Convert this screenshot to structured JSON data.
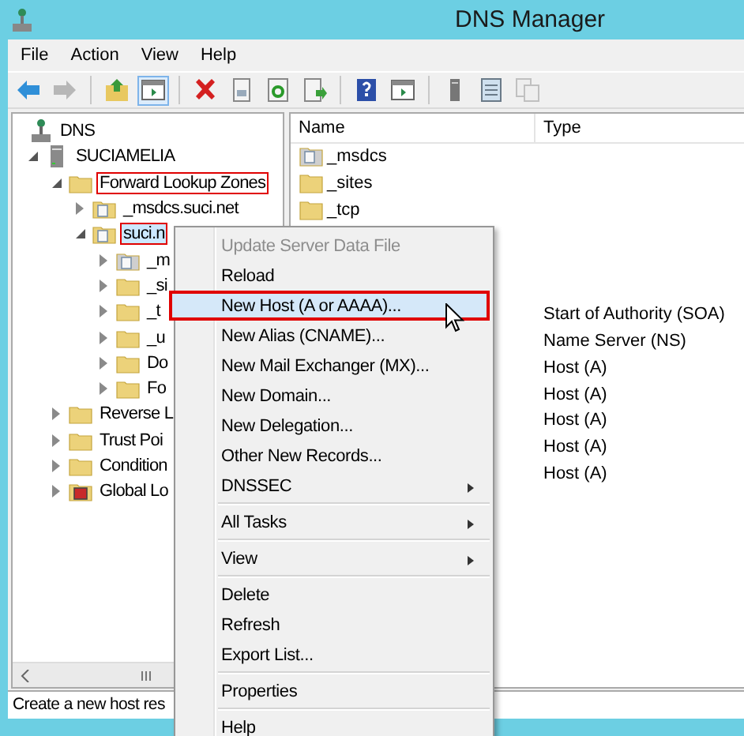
{
  "window": {
    "title": "DNS Manager"
  },
  "menu_bar": [
    "File",
    "Action",
    "View",
    "Help"
  ],
  "toolbar": [
    {
      "kind": "back",
      "disabled": false,
      "pressed": false
    },
    {
      "kind": "forward",
      "disabled": true,
      "pressed": false
    },
    {
      "kind": "sep",
      "disabled": false,
      "pressed": false
    },
    {
      "kind": "up",
      "disabled": false,
      "pressed": false
    },
    {
      "kind": "pane",
      "disabled": false,
      "pressed": true
    },
    {
      "kind": "sep",
      "disabled": false,
      "pressed": false
    },
    {
      "kind": "delete",
      "disabled": false,
      "pressed": false
    },
    {
      "kind": "props",
      "disabled": false,
      "pressed": false
    },
    {
      "kind": "refresh",
      "disabled": false,
      "pressed": false
    },
    {
      "kind": "export",
      "disabled": false,
      "pressed": false
    },
    {
      "kind": "sep",
      "disabled": false,
      "pressed": false
    },
    {
      "kind": "help",
      "disabled": false,
      "pressed": false
    },
    {
      "kind": "action",
      "disabled": false,
      "pressed": false
    },
    {
      "kind": "sep",
      "disabled": false,
      "pressed": false
    },
    {
      "kind": "server",
      "disabled": false,
      "pressed": false
    },
    {
      "kind": "list",
      "disabled": false,
      "pressed": false
    },
    {
      "kind": "copy",
      "disabled": true,
      "pressed": false
    }
  ],
  "tree": [
    {
      "label": "DNS",
      "kind": "dns",
      "selected": false,
      "outlined": false,
      "children": [
        {
          "label": "SUCIAMELIA",
          "kind": "server",
          "expanded": true,
          "selected": false,
          "outlined": false,
          "children": [
            {
              "label": "Forward Lookup Zones",
              "kind": "folder",
              "expanded": true,
              "selected": false,
              "outlined": true,
              "children": [
                {
                  "label": "_msdcs.suci.net",
                  "kind": "zone",
                  "expanded": false,
                  "selected": false,
                  "outlined": false
                },
                {
                  "label": "suci.n",
                  "kind": "zone",
                  "expanded": true,
                  "selected": true,
                  "outlined": true,
                  "children": [
                    {
                      "label": "_m",
                      "kind": "zone-gray",
                      "expanded": false,
                      "selected": false,
                      "outlined": false
                    },
                    {
                      "label": "_si",
                      "kind": "folder",
                      "expanded": false,
                      "selected": false,
                      "outlined": false
                    },
                    {
                      "label": "_t",
                      "kind": "folder",
                      "expanded": false,
                      "selected": false,
                      "outlined": false
                    },
                    {
                      "label": "_u",
                      "kind": "folder",
                      "expanded": false,
                      "selected": false,
                      "outlined": false
                    },
                    {
                      "label": "Do",
                      "kind": "folder",
                      "expanded": false,
                      "selected": false,
                      "outlined": false
                    },
                    {
                      "label": "Fo",
                      "kind": "folder",
                      "expanded": false,
                      "selected": false,
                      "outlined": false
                    }
                  ]
                }
              ]
            },
            {
              "label": "Reverse L",
              "kind": "folder",
              "expanded": false,
              "selected": false,
              "outlined": false
            },
            {
              "label": "Trust Poi",
              "kind": "folder",
              "expanded": false,
              "selected": false,
              "outlined": false
            },
            {
              "label": "Condition",
              "kind": "folder",
              "expanded": false,
              "selected": false,
              "outlined": false
            },
            {
              "label": "Global Lo",
              "kind": "global",
              "expanded": false,
              "selected": false,
              "outlined": false
            }
          ]
        }
      ]
    }
  ],
  "list": {
    "columns": [
      "Name",
      "Type"
    ],
    "rows": [
      {
        "name": "_msdcs",
        "kind": "zone-gray"
      },
      {
        "name": "_sites",
        "kind": "folder"
      },
      {
        "name": "_tcp",
        "kind": "folder"
      },
      {},
      {},
      {},
      {
        "type": "Start of Authority (SOA)"
      },
      {
        "type": "Name Server (NS)"
      },
      {
        "type": "Host (A)"
      },
      {
        "type": "Host (A)"
      },
      {
        "type": "Host (A)"
      },
      {
        "type": "Host (A)"
      },
      {
        "type": "Host (A)"
      }
    ]
  },
  "status_bar": "Create a new host res",
  "context_menu": [
    {
      "kind": "item",
      "label": "Update Server Data File",
      "disabled": true,
      "selected": false,
      "submenu": false,
      "outlined": false
    },
    {
      "kind": "item",
      "label": "Reload",
      "disabled": false,
      "selected": false,
      "submenu": false,
      "outlined": false
    },
    {
      "kind": "item",
      "label": "New Host (A or AAAA)...",
      "disabled": false,
      "selected": true,
      "submenu": false,
      "outlined": true
    },
    {
      "kind": "item",
      "label": "New Alias (CNAME)...",
      "disabled": false,
      "selected": false,
      "submenu": false,
      "outlined": false
    },
    {
      "kind": "item",
      "label": "New Mail Exchanger (MX)...",
      "disabled": false,
      "selected": false,
      "submenu": false,
      "outlined": false
    },
    {
      "kind": "item",
      "label": "New Domain...",
      "disabled": false,
      "selected": false,
      "submenu": false,
      "outlined": false
    },
    {
      "kind": "item",
      "label": "New Delegation...",
      "disabled": false,
      "selected": false,
      "submenu": false,
      "outlined": false
    },
    {
      "kind": "item",
      "label": "Other New Records...",
      "disabled": false,
      "selected": false,
      "submenu": false,
      "outlined": false
    },
    {
      "kind": "item",
      "label": "DNSSEC",
      "disabled": false,
      "selected": false,
      "submenu": true,
      "outlined": false
    },
    {
      "kind": "separator"
    },
    {
      "kind": "item",
      "label": "All Tasks",
      "disabled": false,
      "selected": false,
      "submenu": true,
      "outlined": false
    },
    {
      "kind": "separator"
    },
    {
      "kind": "item",
      "label": "View",
      "disabled": false,
      "selected": false,
      "submenu": true,
      "outlined": false
    },
    {
      "kind": "separator"
    },
    {
      "kind": "item",
      "label": "Delete",
      "disabled": false,
      "selected": false,
      "submenu": false,
      "outlined": false
    },
    {
      "kind": "item",
      "label": "Refresh",
      "disabled": false,
      "selected": false,
      "submenu": false,
      "outlined": false
    },
    {
      "kind": "item",
      "label": "Export List...",
      "disabled": false,
      "selected": false,
      "submenu": false,
      "outlined": false
    },
    {
      "kind": "separator"
    },
    {
      "kind": "item",
      "label": "Properties",
      "disabled": false,
      "selected": false,
      "submenu": false,
      "outlined": false
    },
    {
      "kind": "separator"
    },
    {
      "kind": "item",
      "label": "Help",
      "disabled": false,
      "selected": false,
      "submenu": false,
      "outlined": false
    }
  ]
}
